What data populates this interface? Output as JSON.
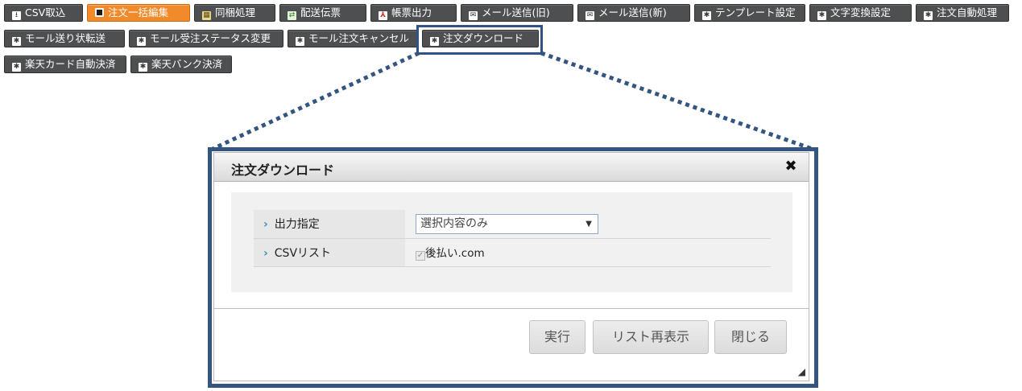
{
  "toolbar": {
    "row1": [
      {
        "icon": "download-icon",
        "label": "CSV取込",
        "state": "normal"
      },
      {
        "icon": "stop-icon",
        "label": "注文一括編集",
        "state": "active"
      },
      {
        "icon": "table-icon",
        "label": "同梱処理",
        "state": "normal"
      },
      {
        "icon": "shipping-slip-icon",
        "label": "配送伝票",
        "state": "normal"
      },
      {
        "icon": "pdf-icon",
        "label": "帳票出力",
        "state": "normal"
      },
      {
        "icon": "mail-icon",
        "label": "メール送信(旧)",
        "state": "normal"
      },
      {
        "icon": "mail-icon",
        "label": "メール送信(新)",
        "state": "normal"
      },
      {
        "icon": "gear-icon",
        "label": "テンプレート設定",
        "state": "normal"
      },
      {
        "icon": "gear-icon",
        "label": "文字変換設定",
        "state": "normal"
      },
      {
        "icon": "gear-icon",
        "label": "注文自動処理",
        "state": "normal"
      }
    ],
    "row2": [
      {
        "icon": "gear-icon",
        "label": "モール送り状転送",
        "state": "normal"
      },
      {
        "icon": "gear-icon",
        "label": "モール受注ステータス変更",
        "state": "normal"
      },
      {
        "icon": "gear-icon",
        "label": "モール注文キャンセル",
        "state": "normal"
      },
      {
        "icon": "gear-icon",
        "label": "注文ダウンロード",
        "state": "selected"
      }
    ],
    "row3": [
      {
        "icon": "gear-icon",
        "label": "楽天カード自動決済",
        "state": "normal"
      },
      {
        "icon": "gear-icon",
        "label": "楽天バンク決済",
        "state": "normal"
      }
    ]
  },
  "dialog": {
    "title": "注文ダウンロード",
    "close_glyph": "✖",
    "fields": {
      "output": {
        "label": "出力指定",
        "value": "選択内容のみ"
      },
      "csv_list": {
        "label": "CSVリスト",
        "option_label": "後払い.com",
        "checked": true
      }
    },
    "buttons": {
      "execute": "実行",
      "refresh_list": "リスト再表示",
      "close": "閉じる"
    }
  },
  "colors": {
    "toolbar_bg": "#4e4f51",
    "toolbar_active": "#f08a2a",
    "highlight": "#2e5487",
    "link_chevron": "#3e8fb9"
  }
}
